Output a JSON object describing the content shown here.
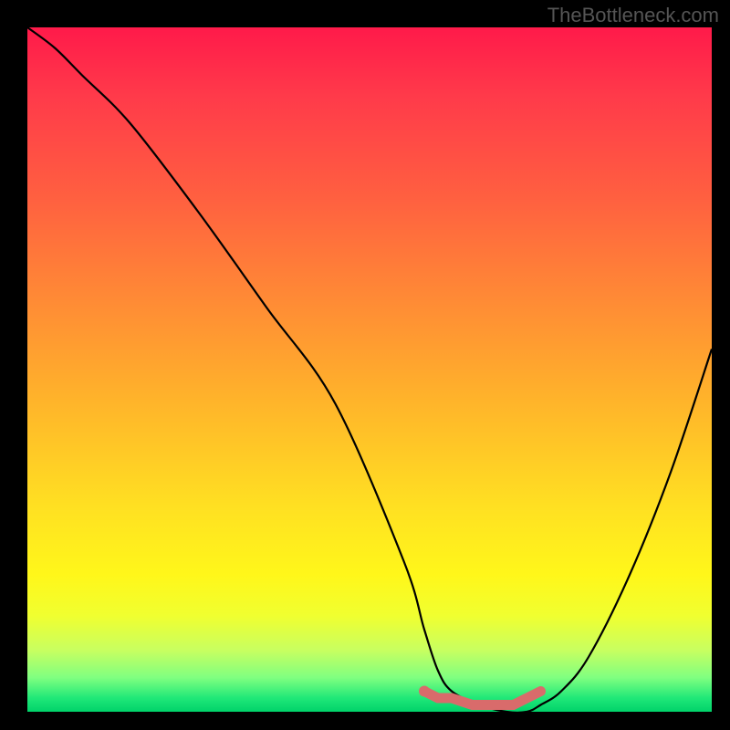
{
  "watermark": "TheBottleneck.com",
  "chart_data": {
    "type": "line",
    "title": "",
    "xlabel": "",
    "ylabel": "",
    "xlim": [
      0,
      100
    ],
    "ylim": [
      0,
      100
    ],
    "series": [
      {
        "name": "curve",
        "x": [
          0,
          4,
          8,
          15,
          25,
          35,
          45,
          55,
          58,
          60,
          62,
          66,
          70,
          73,
          75,
          78,
          82,
          88,
          94,
          100
        ],
        "values": [
          100,
          97,
          93,
          86,
          73,
          59,
          45,
          22,
          12,
          6,
          3,
          1,
          0,
          0,
          1,
          3,
          8,
          20,
          35,
          53
        ]
      },
      {
        "name": "minimum-marker",
        "x": [
          58,
          60,
          62,
          65,
          68,
          71,
          73,
          75
        ],
        "values": [
          3,
          2,
          2,
          1,
          1,
          1,
          2,
          3
        ]
      }
    ],
    "colors": {
      "curve": "#000000",
      "marker": "#d96b6b",
      "marker_outline": "#c85a5a"
    }
  }
}
